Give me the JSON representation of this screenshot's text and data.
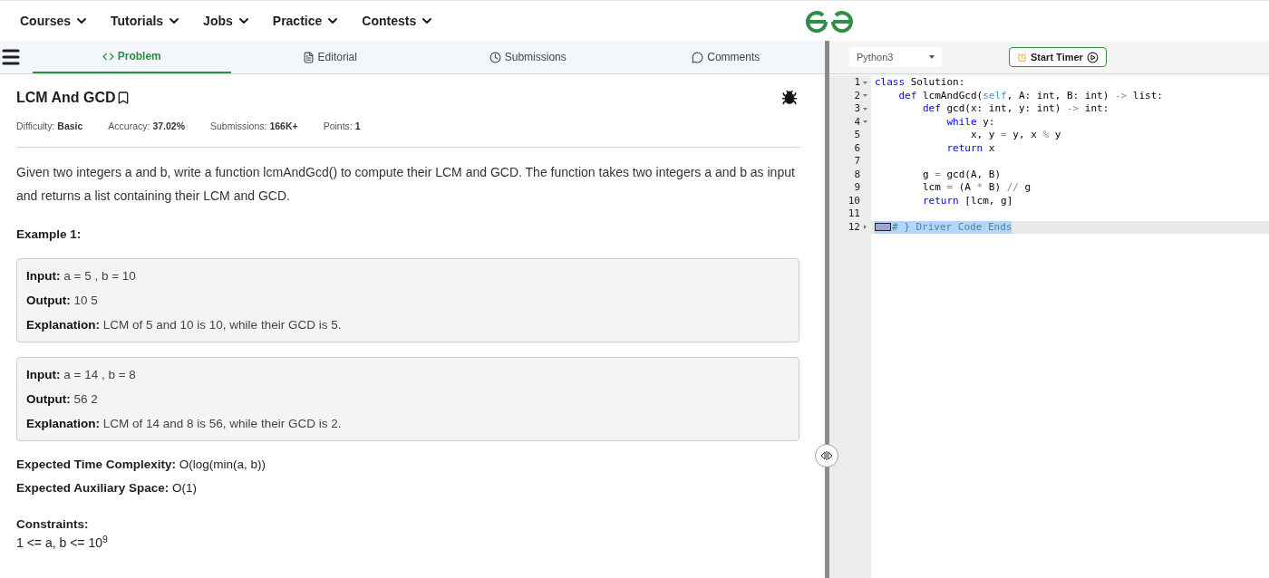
{
  "nav": {
    "items": [
      "Courses",
      "Tutorials",
      "Jobs",
      "Practice",
      "Contests"
    ]
  },
  "tabs": [
    {
      "label": "Problem",
      "selected": true
    },
    {
      "label": "Editorial",
      "selected": false
    },
    {
      "label": "Submissions",
      "selected": false
    },
    {
      "label": "Comments",
      "selected": false
    }
  ],
  "problem": {
    "title": "LCM And GCD",
    "meta": [
      {
        "label": "Difficulty:",
        "value": "Basic"
      },
      {
        "label": "Accuracy:",
        "value": "37.02%"
      },
      {
        "label": "Submissions:",
        "value": "166K+"
      },
      {
        "label": "Points:",
        "value": "1"
      }
    ],
    "description": "Given two integers a and b, write a function lcmAndGcd() to compute their LCM and GCD. The function takes two integers a and b as input and returns a list containing their LCM and GCD.",
    "example_heading": "Example 1:",
    "examples": [
      [
        {
          "label": "Input:",
          "value": "a = 5 , b = 10"
        },
        {
          "label": "Output:",
          "value": "10 5"
        },
        {
          "label": "Explanation:",
          "value": "LCM of 5 and 10 is 10, while their GCD is 5."
        }
      ],
      [
        {
          "label": "Input:",
          "value": "a = 14 , b = 8"
        },
        {
          "label": "Output:",
          "value": "56 2"
        },
        {
          "label": "Explanation:",
          "value": "LCM of 14 and 8 is 56, while their GCD is 2."
        }
      ]
    ],
    "complexity": [
      {
        "label": "Expected Time Complexity:",
        "value": "O(log(min(a, b))"
      },
      {
        "label": "Expected Auxiliary Space:",
        "value": "O(1)"
      }
    ],
    "constraints_heading": "Constraints:",
    "constraints": "1 <= a, b <= 10$^{9}$"
  },
  "editor": {
    "language": "Python3",
    "timer_label": "Start Timer",
    "lines": [
      {
        "number": "1",
        "expanded": true,
        "highlighted": false,
        "tokens": [
          {
            "kind": "keyword",
            "text": "class"
          },
          {
            "kind": "plain",
            "text": " Solution:"
          }
        ]
      },
      {
        "number": "2",
        "expanded": true,
        "highlighted": false,
        "tokens": [
          {
            "kind": "keyword",
            "text": "    def"
          },
          {
            "kind": "plain",
            "text": " lcmAndGcd("
          },
          {
            "kind": "builtin",
            "text": "self"
          },
          {
            "kind": "plain",
            "text": ", A: int, B: int) "
          },
          {
            "kind": "operator",
            "text": "->"
          },
          {
            "kind": "plain",
            "text": " list:"
          }
        ]
      },
      {
        "number": "3",
        "expanded": true,
        "highlighted": false,
        "tokens": [
          {
            "kind": "keyword",
            "text": "        def"
          },
          {
            "kind": "plain",
            "text": " gcd(x: int, y: int) "
          },
          {
            "kind": "operator",
            "text": "->"
          },
          {
            "kind": "plain",
            "text": " int:"
          }
        ]
      },
      {
        "number": "4",
        "expanded": true,
        "highlighted": false,
        "tokens": [
          {
            "kind": "keyword",
            "text": "            while"
          },
          {
            "kind": "plain",
            "text": " y:"
          }
        ]
      },
      {
        "number": "5",
        "highlighted": false,
        "tokens": [
          {
            "kind": "plain",
            "text": "                x, y "
          },
          {
            "kind": "operator",
            "text": "="
          },
          {
            "kind": "plain",
            "text": " y, x "
          },
          {
            "kind": "operator",
            "text": "%"
          },
          {
            "kind": "plain",
            "text": " y"
          }
        ]
      },
      {
        "number": "6",
        "highlighted": false,
        "tokens": [
          {
            "kind": "keyword",
            "text": "            return"
          },
          {
            "kind": "plain",
            "text": " x"
          }
        ]
      },
      {
        "number": "7",
        "highlighted": false
      },
      {
        "number": "8",
        "highlighted": false,
        "tokens": [
          {
            "kind": "plain",
            "text": "        g "
          },
          {
            "kind": "operator",
            "text": "="
          },
          {
            "kind": "plain",
            "text": " gcd(A, B)"
          }
        ]
      },
      {
        "number": "9",
        "highlighted": false,
        "tokens": [
          {
            "kind": "plain",
            "text": "        lcm "
          },
          {
            "kind": "operator",
            "text": "="
          },
          {
            "kind": "plain",
            "text": " (A "
          },
          {
            "kind": "operator",
            "text": "*"
          },
          {
            "kind": "plain",
            "text": " B) "
          },
          {
            "kind": "operator",
            "text": "//"
          },
          {
            "kind": "plain",
            "text": " g"
          }
        ]
      },
      {
        "number": "10",
        "highlighted": false,
        "tokens": [
          {
            "kind": "keyword",
            "text": "        return"
          },
          {
            "kind": "plain",
            "text": " [lcm, g]"
          }
        ]
      },
      {
        "number": "11",
        "highlighted": false
      },
      {
        "number": "12",
        "expanded": false,
        "highlighted": true,
        "tokens": [
          {
            "kind": "comment",
            "text": "# } Driver Code Ends"
          }
        ]
      }
    ]
  }
}
